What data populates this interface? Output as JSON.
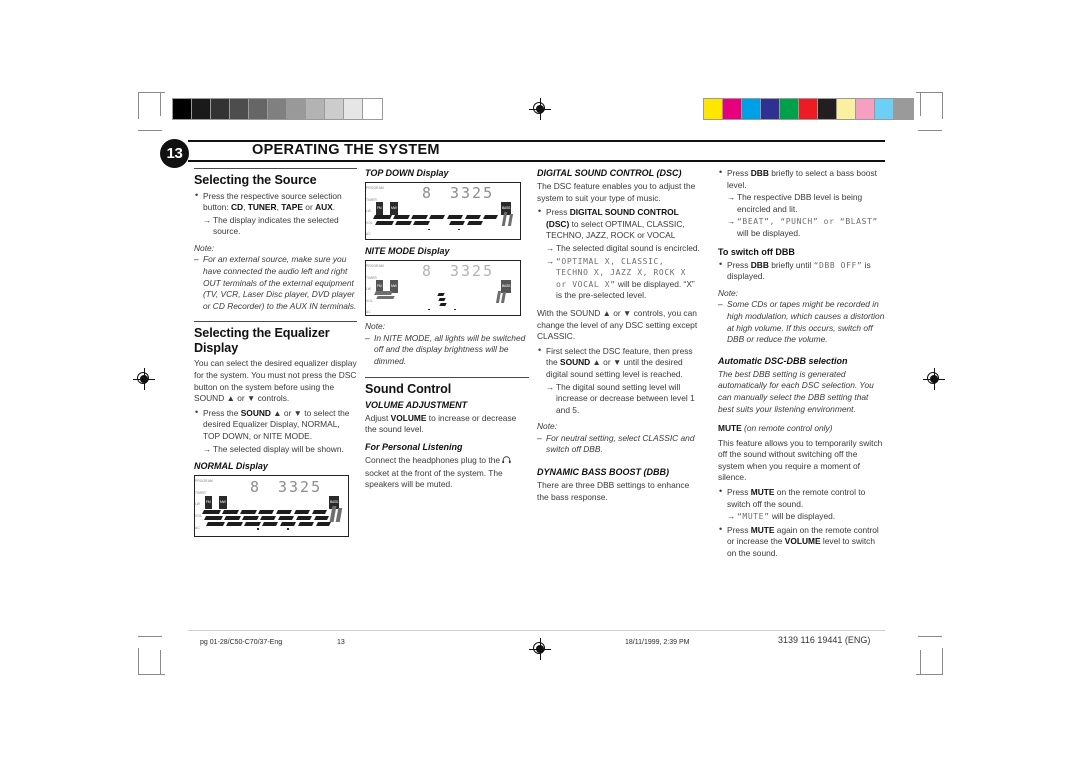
{
  "page": {
    "number": "13",
    "header_title": "OPERATING THE SYSTEM"
  },
  "calibration": {
    "gray_bar": [
      "#000000",
      "#1a1a1a",
      "#333333",
      "#4d4d4d",
      "#666666",
      "#808080",
      "#999999",
      "#b3b3b3",
      "#cccccc",
      "#e6e6e6",
      "#ffffff"
    ],
    "color_bar": [
      "#ffe600",
      "#e6007e",
      "#00a0e4",
      "#2e3192",
      "#00a14b",
      "#ed1c24",
      "#231f20",
      "#faf0a0",
      "#f79fc0",
      "#6ecff6",
      "#9a9a9a"
    ]
  },
  "col1": {
    "section1_title": "Selecting the Source",
    "bullet1_a": "Press the respective source selection button: ",
    "bullet1_b": "CD",
    "bullet1_c": ", ",
    "bullet1_d": "TUNER",
    "bullet1_e": ", ",
    "bullet1_f": "TAPE",
    "bullet1_g": " or ",
    "bullet1_h": "AUX",
    "bullet1_i": ".",
    "bullet1_arrow": "The display indicates the selected source.",
    "note_label": "Note:",
    "note_item": "For an external source, make sure you have connected the audio left and right OUT terminals of the external equipment (TV, VCR, Laser Disc player, DVD player or CD Recorder) to the AUX IN terminals.",
    "section2_title": "Selecting the Equalizer Display",
    "section2_body": "You can select the desired equalizer display for the system. You must not press the DSC button on the system before using the SOUND ▲ or ▼ controls.",
    "section2_bullet_a": "Press the ",
    "section2_bullet_b": "SOUND",
    "section2_bullet_c": " ▲ or ▼ to select the desired Equalizer Display, NORMAL, TOP DOWN, or NITE MODE.",
    "section2_arrow": "The selected display will be shown.",
    "normal_display_caption": "NORMAL Display"
  },
  "col2": {
    "topdown_caption": "TOP DOWN Display",
    "nite_caption": "NITE MODE Display",
    "note_label": "Note:",
    "note_item_a": "In NITE MODE,",
    "note_item_b": " all lights will be switched off and the display brightness will be dimmed.",
    "section_title": "Sound Control",
    "volume_heading": "VOLUME ADJUSTMENT",
    "volume_body_a": "Adjust ",
    "volume_body_b": "VOLUME",
    "volume_body_c": " to increase or decrease the sound level.",
    "personal_heading": "For Personal Listening",
    "personal_body_a": "Connect the headphones plug to the ",
    "personal_body_b": " socket at the front of the system. The speakers will be muted."
  },
  "col3": {
    "dsc_heading": "DIGITAL SOUND CONTROL (DSC)",
    "dsc_body": "The DSC feature enables you to adjust the system to suit your type of music.",
    "dsc_bullet_a": "Press ",
    "dsc_bullet_b": "DIGITAL SOUND CONTROL (DSC)",
    "dsc_bullet_c": " to select OPTIMAL, CLASSIC, TECHNO, JAZZ, ROCK or VOCAL",
    "dsc_arrow1": "The selected digital sound is encircled.",
    "dsc_arrow2_lcd": "“OPTIMAL X, CLASSIC, TECHNO X, JAZZ X, ROCK X or VOCAL X”",
    "dsc_arrow2_tail": " will be displayed. “X” is the pre-selected level.",
    "dsc_para2": "With the SOUND ▲ or ▼ controls, you can change the level of any DSC setting except CLASSIC.",
    "dsc_bullet2_a": "First select the DSC feature, then press the ",
    "dsc_bullet2_b": "SOUND",
    "dsc_bullet2_c": " ▲ or ▼ until the desired digital sound setting level is reached.",
    "dsc_bullet2_arrow": "The digital sound setting level will increase or decrease between level 1 and 5.",
    "note_label": "Note:",
    "note_item": "For neutral setting, select CLASSIC and switch off DBB.",
    "dbb_heading": "DYNAMIC BASS BOOST (DBB)",
    "dbb_body": "There are three DBB settings to enhance the bass response."
  },
  "col4": {
    "bullet1_a": "Press ",
    "bullet1_b": "DBB",
    "bullet1_c": " briefly to select a bass boost level.",
    "bullet1_arrow1": "The respective DBB level is being encircled and lit.",
    "bullet1_arrow2_lcd": "“BEAT”, “PUNCH” or “BLAST”",
    "bullet1_arrow2_tail": " will be displayed.",
    "switchoff_heading": "To switch off DBB",
    "switchoff_bullet_a": "Press ",
    "switchoff_bullet_b": "DBB",
    "switchoff_bullet_c": " briefly until ",
    "switchoff_bullet_lcd": "“DBB OFF”",
    "switchoff_bullet_d": " is displayed.",
    "note_label": "Note:",
    "note_item": "Some CDs or tapes might be recorded in high modulation, which causes a distortion at high volume. If this occurs, switch off DBB or reduce the volume.",
    "auto_heading": "Automatic DSC-DBB selection",
    "auto_body": "The best DBB setting is generated automatically for each DSC selection. You can manually select the DBB setting that best suits your listening environment.",
    "mute_heading_a": "MUTE",
    "mute_heading_b": " (on remote control only)",
    "mute_body": "This feature allows you to temporarily switch off the sound without switching off the system when you require a moment of silence.",
    "mute_bullet1_a": "Press ",
    "mute_bullet1_b": "MUTE",
    "mute_bullet1_c": " on the remote control to switch off the sound.",
    "mute_bullet1_arrow_lcd": "“MUTE”",
    "mute_bullet1_arrow_tail": " will be displayed.",
    "mute_bullet2_a": "Press ",
    "mute_bullet2_b": "MUTE",
    "mute_bullet2_c": " again on the remote control or increase the ",
    "mute_bullet2_d": "VOLUME",
    "mute_bullet2_e": " level to switch on the sound."
  },
  "lcd": {
    "big_digit": "8",
    "track_number": "3325",
    "micro_top": "PROGRAM",
    "micro_top2": "TIMER",
    "tag_fm": "FM",
    "tag_mw": "MW",
    "tag_lw": "LW",
    "tag_vol": "VOL",
    "tag_ac": "AC",
    "tag_bass": "BASS",
    "band_labels": [
      "OPTIMAL",
      "CLASSIC",
      "TECHNO",
      "JAZZ",
      "ROCK",
      "VOCAL"
    ],
    "dbb_labels": [
      "BEAT",
      "PUNCH",
      "BLAST"
    ]
  },
  "footer": {
    "left": "pg 01-28/C50-C70/37-Eng",
    "page": "13",
    "date": "18/11/1999, 2:39 PM",
    "code": "3139 116 19441 (ENG)"
  }
}
